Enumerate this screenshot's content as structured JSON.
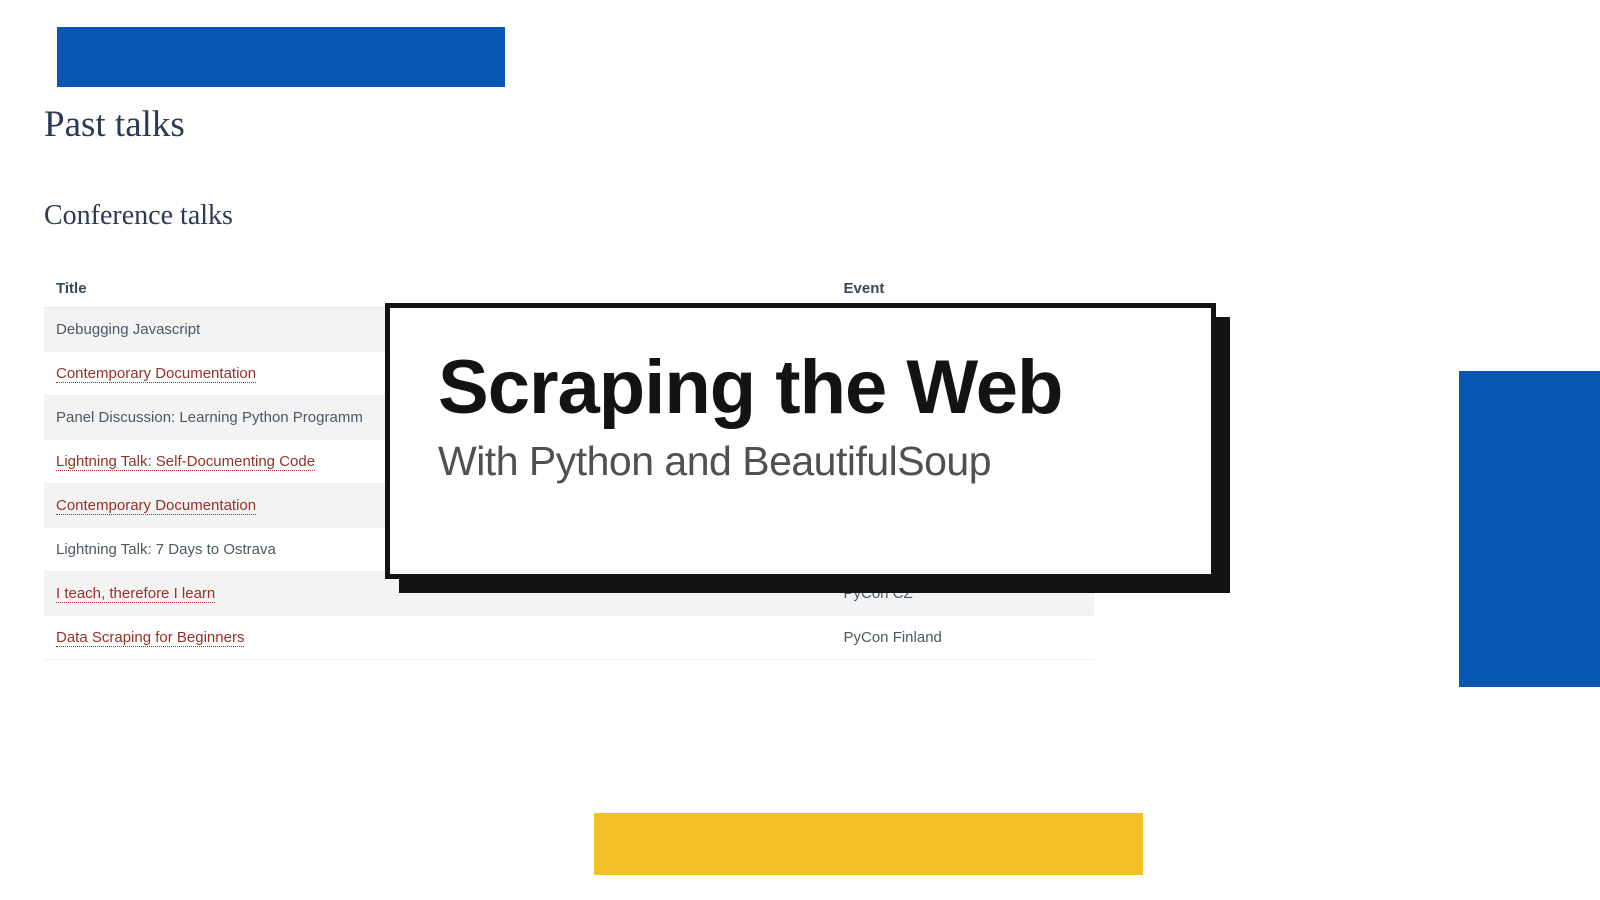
{
  "page": {
    "title": "Past talks",
    "section_title": "Conference talks"
  },
  "table": {
    "headers": {
      "title": "Title",
      "event": "Event"
    },
    "rows": [
      {
        "title": "Debugging Javascript",
        "event": "",
        "is_link": false
      },
      {
        "title": "Contemporary Documentation",
        "event": "",
        "is_link": true
      },
      {
        "title": "Panel Discussion: Learning Python Programm",
        "event": "",
        "is_link": false
      },
      {
        "title": "Lightning Talk: Self-Documenting Code",
        "event": "",
        "is_link": true
      },
      {
        "title": "Contemporary Documentation",
        "event": "",
        "is_link": true
      },
      {
        "title": "Lightning Talk: 7 Days to Ostrava",
        "event": "",
        "is_link": false
      },
      {
        "title": "I teach, therefore I learn",
        "event": "PyCon CZ",
        "is_link": true
      },
      {
        "title": "Data Scraping for Beginners",
        "event": "PyCon Finland",
        "is_link": true
      }
    ]
  },
  "overlay": {
    "title": "Scraping the Web",
    "subtitle": "With Python and BeautifulSoup"
  },
  "colors": {
    "blue": "#0858b4",
    "yellow": "#f3c028",
    "link_red": "#983029",
    "heading": "#2c3b52"
  }
}
